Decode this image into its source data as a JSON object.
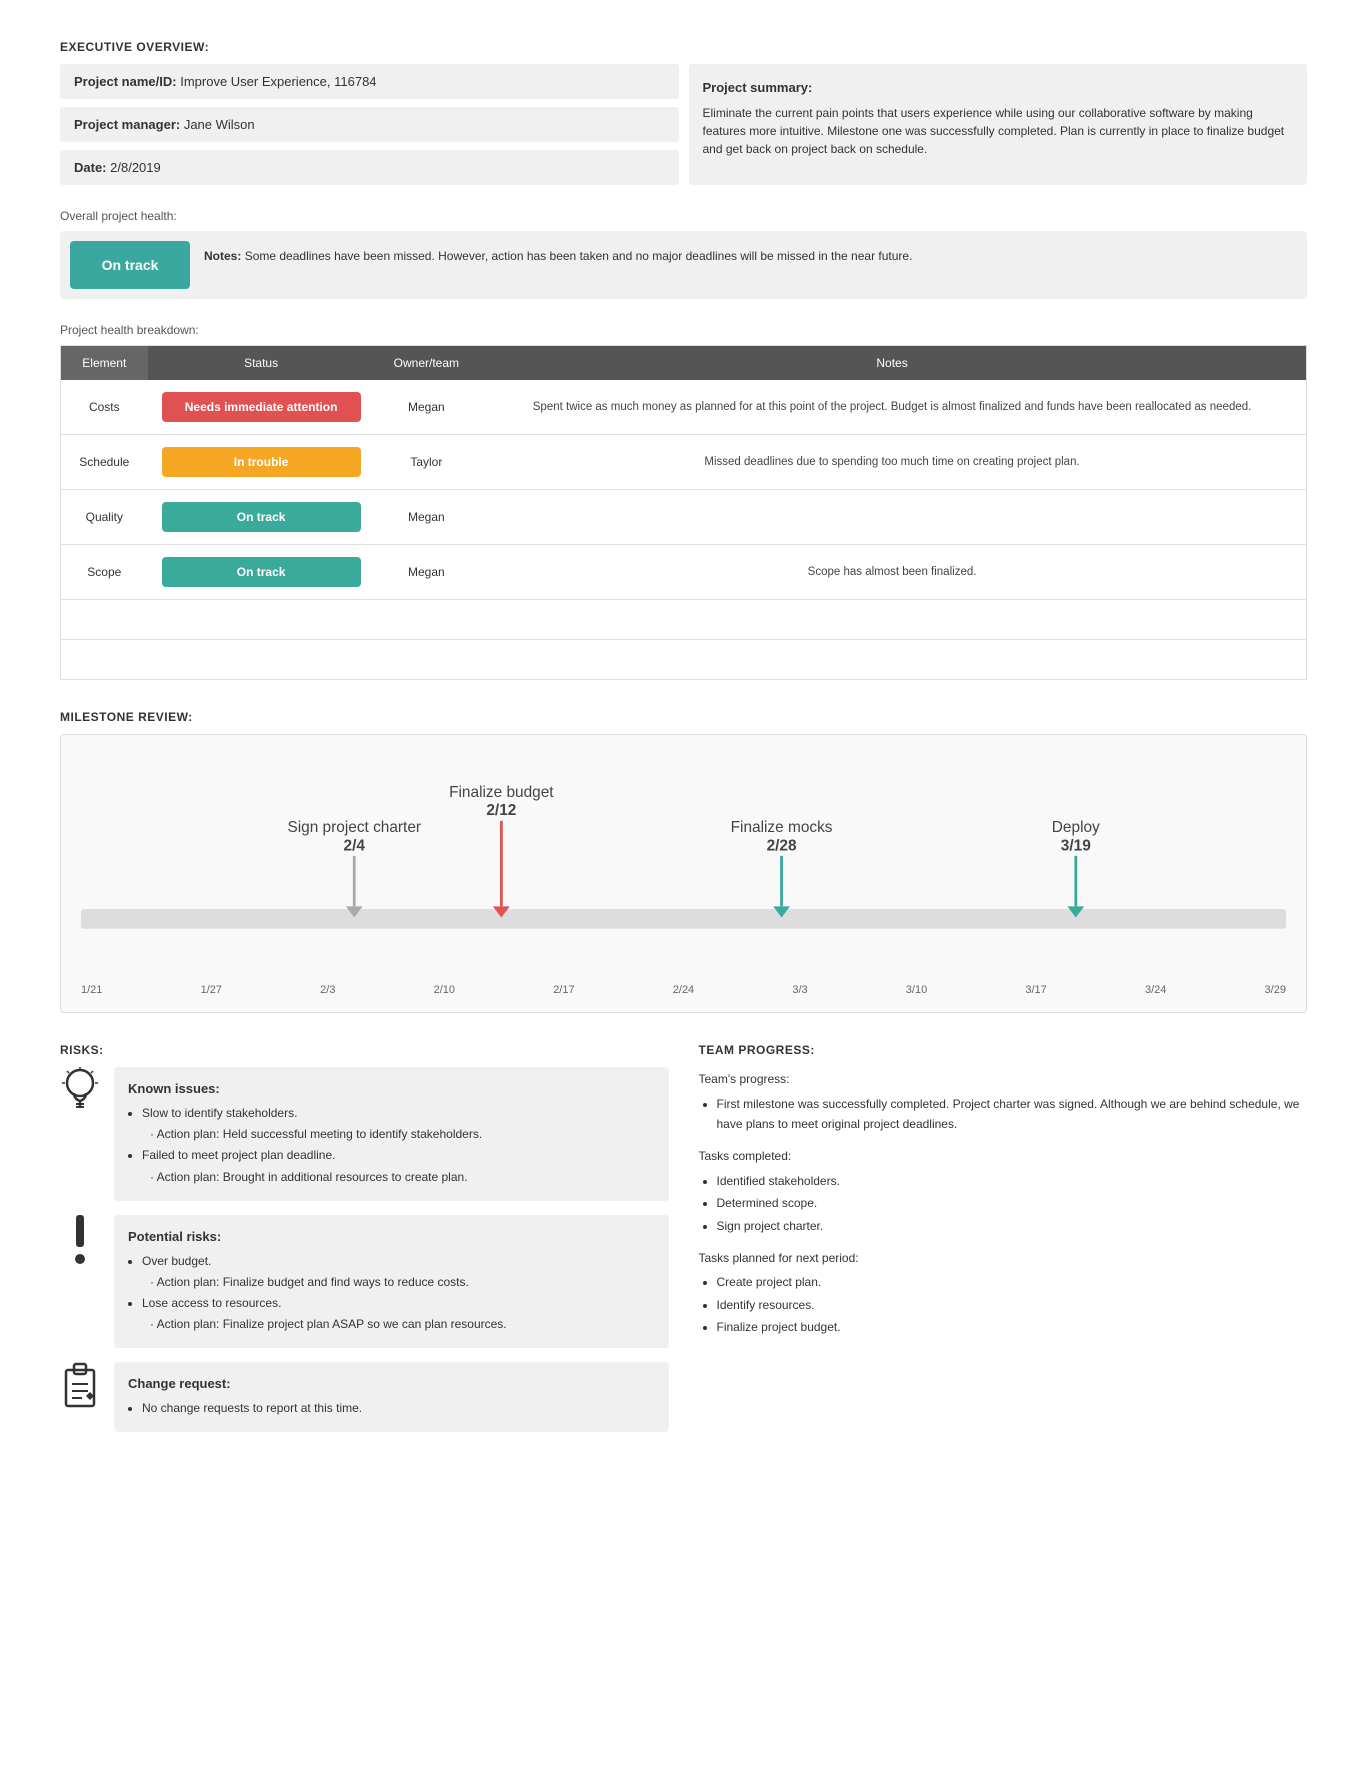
{
  "execOverview": {
    "sectionTitle": "EXECUTIVE OVERVIEW:",
    "projectName": "Project name/ID:",
    "projectNameValue": "Improve User Experience, 116784",
    "projectManager": "Project manager:",
    "projectManagerValue": "Jane Wilson",
    "date": "Date:",
    "dateValue": "2/8/2019",
    "summaryTitle": "Project summary:",
    "summaryText": "Eliminate the current pain points that users experience while using our collaborative software by making features more intuitive. Milestone one was successfully completed. Plan is currently in place to finalize budget and get back on project back on schedule."
  },
  "overallHealth": {
    "label": "Overall project health:",
    "status": "On track",
    "notesLabel": "Notes:",
    "notesText": "Some deadlines have been missed. However, action has been taken and no major deadlines will be missed in the near future."
  },
  "breakdown": {
    "label": "Project health breakdown:",
    "headers": [
      "Element",
      "Status",
      "Owner/team",
      "Notes"
    ],
    "rows": [
      {
        "element": "Costs",
        "status": "Needs immediate attention",
        "statusClass": "status-red",
        "owner": "Megan",
        "notes": "Spent twice as much money as planned for at this point of the project. Budget is almost finalized and funds have been reallocated as needed."
      },
      {
        "element": "Schedule",
        "status": "In trouble",
        "statusClass": "status-orange",
        "owner": "Taylor",
        "notes": "Missed deadlines due to spending too much time on creating project plan."
      },
      {
        "element": "Quality",
        "status": "On track",
        "statusClass": "status-teal",
        "owner": "Megan",
        "notes": ""
      },
      {
        "element": "Scope",
        "status": "On track",
        "statusClass": "status-teal",
        "owner": "Megan",
        "notes": "Scope has almost been finalized."
      },
      {
        "element": "",
        "status": "",
        "statusClass": "",
        "owner": "",
        "notes": ""
      },
      {
        "element": "",
        "status": "",
        "statusClass": "",
        "owner": "",
        "notes": ""
      }
    ]
  },
  "milestoneReview": {
    "sectionTitle": "MILESTONE REVIEW:",
    "milestones": [
      {
        "label": "Sign project charter",
        "date": "2/4",
        "color": "gray"
      },
      {
        "label": "Finalize budget",
        "date": "2/12",
        "color": "red"
      },
      {
        "label": "Finalize mocks",
        "date": "2/28",
        "color": "teal"
      },
      {
        "label": "Deploy",
        "date": "3/19",
        "color": "teal"
      }
    ],
    "xAxis": [
      "1/21",
      "1/27",
      "2/3",
      "2/10",
      "2/17",
      "2/24",
      "3/3",
      "3/10",
      "3/17",
      "3/24",
      "3/29"
    ]
  },
  "risks": {
    "sectionTitle": "RISKS:",
    "items": [
      {
        "icon": "bulb",
        "title": "Known issues:",
        "bullets": [
          "Slow to identify stakeholders.",
          "Action plan: Held successful meeting to identify stakeholders.",
          "Failed to meet project plan deadline.",
          "Action plan: Brought in additional resources to create plan."
        ]
      },
      {
        "icon": "exclaim",
        "title": "Potential risks:",
        "bullets": [
          "Over budget.",
          "Action plan: Finalize budget and find ways to reduce costs.",
          "Lose access to resources.",
          "Action plan: Finalize project plan ASAP so we can plan resources."
        ]
      },
      {
        "icon": "clipboard",
        "title": "Change request:",
        "bullets": [
          "No change requests to report at this time."
        ]
      }
    ]
  },
  "teamProgress": {
    "sectionTitle": "TEAM PROGRESS:",
    "progressLabel": "Team's progress:",
    "progressBullets": [
      "First milestone was successfully completed. Project charter was signed. Although we are behind schedule, we have plans to meet original project deadlines."
    ],
    "completedLabel": "Tasks completed:",
    "completedBullets": [
      "Identified stakeholders.",
      "Determined scope.",
      "Sign project charter."
    ],
    "plannedLabel": "Tasks planned for next period:",
    "plannedBullets": [
      "Create project plan.",
      "Identify resources.",
      "Finalize project budget."
    ]
  }
}
